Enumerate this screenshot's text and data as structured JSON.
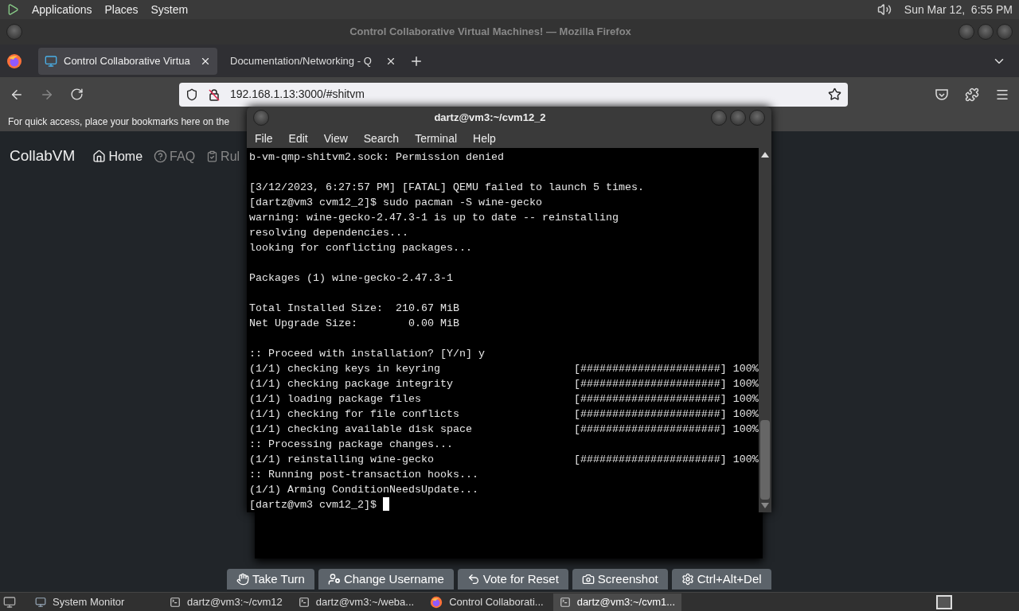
{
  "top_panel": {
    "menus": [
      "Applications",
      "Places",
      "System"
    ],
    "clock": "Sun Mar 12,  6:55 PM"
  },
  "browser": {
    "title": "Control Collaborative Virtual Machines! — Mozilla Firefox",
    "tabs": [
      {
        "title": "Control Collaborative Virtua",
        "selected": true
      },
      {
        "title": "Documentation/Networking - Q",
        "selected": false
      }
    ],
    "url": "192.168.1.13:3000/#shitvm",
    "bookmarks_hint": "For quick access, place your bookmarks here on the",
    "page": {
      "brand": "CollabVM",
      "nav": [
        "Home",
        "FAQ",
        "Rul"
      ],
      "buttons": [
        "Take Turn",
        "Change Username",
        "Vote for Reset",
        "Screenshot",
        "Ctrl+Alt+Del"
      ]
    }
  },
  "terminal": {
    "title": "dartz@vm3:~/cvm12_2",
    "menu": [
      "File",
      "Edit",
      "View",
      "Search",
      "Terminal",
      "Help"
    ],
    "blocks": [
      [
        "b-vm-qmp-shitvm2.sock: Permission denied"
      ],
      [
        "[3/12/2023, 6:27:57 PM] [FATAL] QEMU failed to launch 5 times.",
        "[dartz@vm3 cvm12_2]$ sudo pacman -S wine-gecko",
        "warning: wine-gecko-2.47.3-1 is up to date -- reinstalling",
        "resolving dependencies...",
        "looking for conflicting packages..."
      ],
      [
        "Packages (1) wine-gecko-2.47.3-1"
      ],
      [
        "Total Installed Size:  210.67 MiB",
        "Net Upgrade Size:        0.00 MiB"
      ],
      [
        ":: Proceed with installation? [Y/n] y",
        "(1/1) checking keys in keyring                     [######################] 100%",
        "(1/1) checking package integrity                   [######################] 100%",
        "(1/1) loading package files                        [######################] 100%",
        "(1/1) checking for file conflicts                  [######################] 100%",
        "(1/1) checking available disk space                [######################] 100%",
        ":: Processing package changes...",
        "(1/1) reinstalling wine-gecko                      [######################] 100%",
        ":: Running post-transaction hooks...",
        "(1/1) Arming ConditionNeedsUpdate...",
        "[dartz@vm3 cvm12_2]$ "
      ]
    ]
  },
  "taskbar": {
    "items": [
      {
        "label": "System Monitor",
        "kind": "monitor",
        "selected": false
      },
      {
        "label": "dartz@vm3:~/cvm12",
        "kind": "terminal",
        "selected": false
      },
      {
        "label": "dartz@vm3:~/weba...",
        "kind": "terminal",
        "selected": false
      },
      {
        "label": "Control Collaborati...",
        "kind": "browser",
        "selected": false
      },
      {
        "label": "dartz@vm3:~/cvm1...",
        "kind": "terminal",
        "selected": true
      }
    ]
  }
}
